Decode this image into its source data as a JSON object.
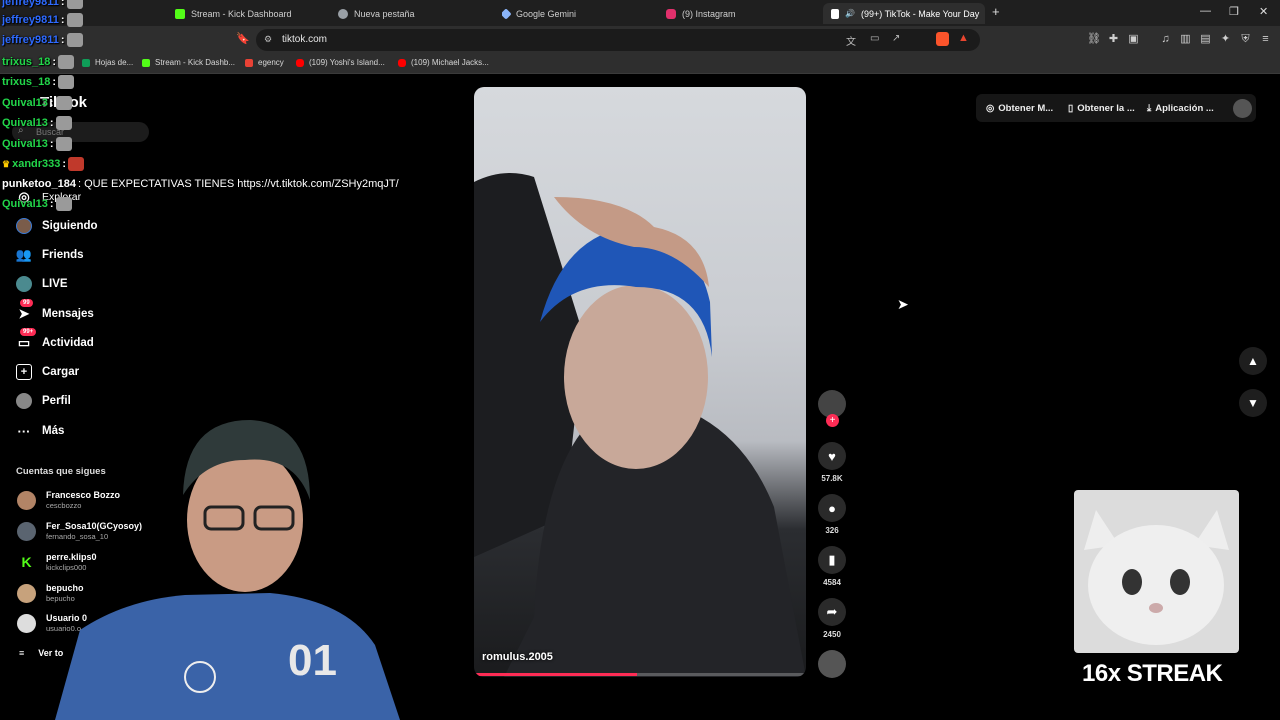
{
  "browser": {
    "tabs": [
      {
        "label": "Stream - Kick Dashboard",
        "color": "#53fc18"
      },
      {
        "label": "Nueva pestaña",
        "color": "#9aa0a6"
      },
      {
        "label": "Google Gemini",
        "color": "#8ab4f8"
      },
      {
        "label": "(9) Instagram",
        "color": "#e1306c"
      },
      {
        "label": "(99+) TikTok - Make Your Day",
        "color": "#ffffff"
      }
    ],
    "url": "tiktok.com",
    "bookmarks": [
      {
        "label": "Hojas de...",
        "color": "#0f9d58"
      },
      {
        "label": "Stream - Kick Dashb...",
        "color": "#53fc18"
      },
      {
        "label": "egency",
        "color": "#e94235"
      },
      {
        "label": "(109) Yoshi's Island...",
        "color": "#ff0000"
      },
      {
        "label": "(109) Michael Jacks...",
        "color": "#ff0000"
      }
    ]
  },
  "tiktok": {
    "logo": "TikTok",
    "search_placeholder": "Buscar",
    "nav": [
      {
        "label": "Explorar",
        "icon": "compass-icon"
      },
      {
        "label": "Siguiendo",
        "icon": "following-avatar-icon"
      },
      {
        "label": "Friends",
        "icon": "friends-icon"
      },
      {
        "label": "LIVE",
        "icon": "live-icon"
      },
      {
        "label": "Mensajes",
        "icon": "messages-icon",
        "badge": "99"
      },
      {
        "label": "Actividad",
        "icon": "activity-icon",
        "badge": "99+"
      },
      {
        "label": "Cargar",
        "icon": "upload-icon"
      },
      {
        "label": "Perfil",
        "icon": "profile-icon"
      },
      {
        "label": "Más",
        "icon": "more-icon"
      }
    ],
    "following_title": "Cuentas que sigues",
    "following": [
      {
        "name": "Francesco Bozzo",
        "handle": "cescbozzo"
      },
      {
        "name": "Fer_Sosa10(GCyosoy)",
        "handle": "fernando_sosa_10"
      },
      {
        "name": "perre.klips0",
        "handle": "kickclips000"
      },
      {
        "name": "bepucho",
        "handle": "bepucho"
      },
      {
        "name": "Usuario 0",
        "handle": "usuario0.o"
      }
    ],
    "see_all": "Ver to",
    "top_buttons": [
      "Obtener M...",
      "Obtener la ...",
      "Aplicación ..."
    ],
    "video": {
      "author": "romulus.2005",
      "likes": "57.8K",
      "comments": "326",
      "saves": "4584",
      "shares": "2450",
      "progress": 0.49
    }
  },
  "chat": [
    {
      "user": "jeffrey9811",
      "msg": ":",
      "color": "#2f6bff"
    },
    {
      "user": "jeffrey9811",
      "msg": ":",
      "color": "#2f6bff"
    },
    {
      "user": "jeffrey9811",
      "msg": ":",
      "color": "#2f6bff"
    },
    {
      "user": "trixus_18",
      "msg": ":",
      "color": "#22d64a"
    },
    {
      "user": "trixus_18",
      "msg": ":",
      "color": "#22d64a"
    },
    {
      "user": "Quival13",
      "msg": ":",
      "color": "#22d64a"
    },
    {
      "user": "Quival13",
      "msg": ":",
      "color": "#22d64a"
    },
    {
      "user": "Quival13",
      "msg": ":",
      "color": "#22d64a"
    },
    {
      "user": "xandr333",
      "msg": ":",
      "color": "#22d64a"
    },
    {
      "user": "punketoo_184",
      "msg": ": QUE EXPECTATIVAS TIENES https://vt.tiktok.com/ZSHy2mqJT/",
      "color": "#ffffff"
    },
    {
      "user": "Quival13",
      "msg": ":",
      "color": "#22d64a"
    }
  ],
  "overlay": {
    "streak": "16x STREAK"
  }
}
